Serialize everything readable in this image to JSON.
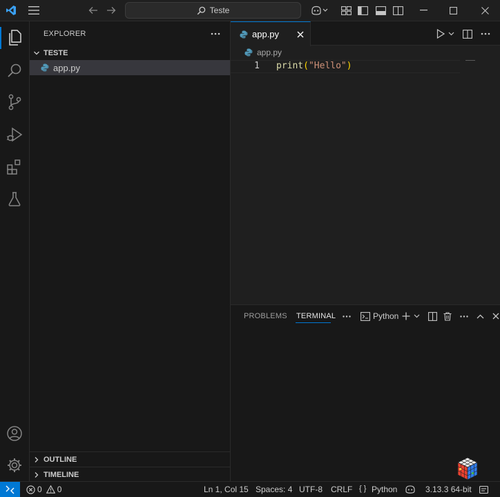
{
  "titlebar": {
    "search_text": "Teste"
  },
  "sidebar": {
    "title": "EXPLORER",
    "folder": "TESTE",
    "files": [
      {
        "name": "app.py"
      }
    ],
    "outline_label": "OUTLINE",
    "timeline_label": "TIMELINE"
  },
  "editor": {
    "tab_label": "app.py",
    "breadcrumb": "app.py",
    "lines": [
      {
        "number": "1",
        "fn": "print",
        "open": "(",
        "string": "\"Hello\"",
        "close": ")"
      }
    ]
  },
  "panel": {
    "tabs": [
      "PROBLEMS",
      "TERMINAL"
    ],
    "active_tab": "TERMINAL",
    "terminal_name": "Python"
  },
  "statusbar": {
    "errors": "0",
    "warnings": "0",
    "position": "Ln 1, Col 15",
    "spaces": "Spaces: 4",
    "encoding": "UTF-8",
    "eol": "CRLF",
    "braces": "{ }",
    "language": "Python",
    "interpreter": "3.13.3 64-bit"
  },
  "colors": {
    "accent": "#0078d4",
    "function": "#dcdcaa",
    "string": "#ce9178",
    "bracket": "#ffd700",
    "python_blue": "#519aba"
  }
}
